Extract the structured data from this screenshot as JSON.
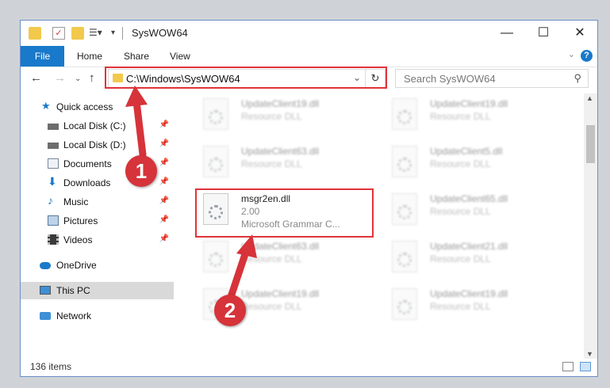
{
  "window": {
    "title": "SysWOW64",
    "minimize": "—",
    "maximize": "☐",
    "close": "✕"
  },
  "ribbon": {
    "tabs": [
      "File",
      "Home",
      "Share",
      "View"
    ],
    "help": "?"
  },
  "nav": {
    "address": "C:\\Windows\\SysWOW64",
    "search_placeholder": "Search SysWOW64"
  },
  "sidebar": {
    "items": [
      {
        "label": "Quick access",
        "icon": "star-icon"
      },
      {
        "label": "Local Disk (C:)",
        "icon": "drive-icon",
        "pinned": true
      },
      {
        "label": "Local Disk (D:)",
        "icon": "drive-icon",
        "pinned": true
      },
      {
        "label": "Documents",
        "icon": "documents-icon",
        "pinned": true
      },
      {
        "label": "Downloads",
        "icon": "downloads-icon",
        "pinned": true
      },
      {
        "label": "Music",
        "icon": "music-icon",
        "pinned": true
      },
      {
        "label": "Pictures",
        "icon": "pictures-icon",
        "pinned": true
      },
      {
        "label": "Videos",
        "icon": "videos-icon",
        "pinned": true
      },
      {
        "label": "OneDrive",
        "icon": "onedrive-icon"
      },
      {
        "label": "This PC",
        "icon": "this-pc-icon",
        "selected": true
      },
      {
        "label": "Network",
        "icon": "network-icon"
      }
    ]
  },
  "files": {
    "left": [
      {
        "name": "UpdateClient19.dll",
        "type": "Resource DLL"
      },
      {
        "name": "UpdateClient63.dll",
        "type": "Resource DLL"
      },
      {
        "name": "msgr2en.dll",
        "type": "2.00",
        "desc": "Microsoft Grammar C..."
      },
      {
        "name": "UpdateClient63.dll",
        "type": "Resource DLL"
      },
      {
        "name": "UpdateClient19.dll",
        "type": "Resource DLL"
      }
    ],
    "right": [
      {
        "name": "UpdateClient19.dll",
        "type": "Resource DLL"
      },
      {
        "name": "UpdateClient5.dll",
        "type": "Resource DLL"
      },
      {
        "name": "UpdateClient65.dll",
        "type": "Resource DLL"
      },
      {
        "name": "UpdateClient21.dll",
        "type": "Resource DLL"
      },
      {
        "name": "UpdateClient19.dll",
        "type": "Resource DLL"
      }
    ]
  },
  "status": {
    "item_count": "136 items"
  },
  "annotations": {
    "step1": "1",
    "step2": "2",
    "highlight_color": "#e0333a"
  }
}
